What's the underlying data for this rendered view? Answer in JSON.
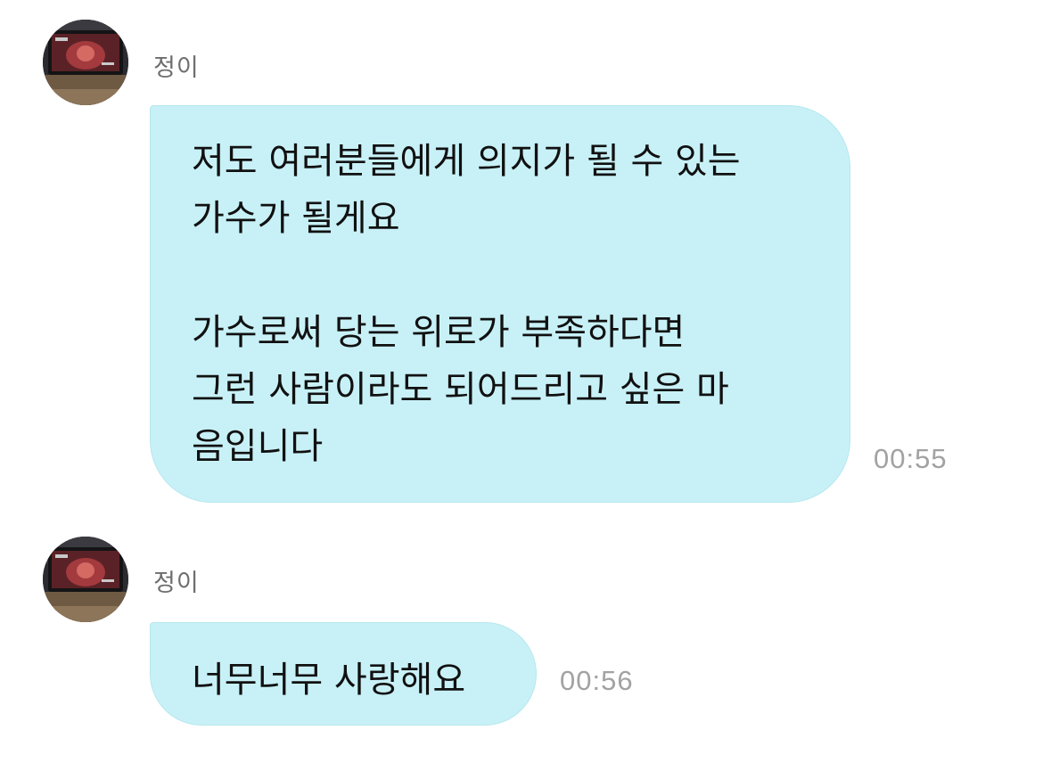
{
  "messages": [
    {
      "sender": "정이",
      "avatar": "performer-photo-avatar",
      "lines": [
        "저도 여러분들에게 의지가 될 수 있는",
        "가수가 될게요",
        "",
        "가수로써 당는 위로가 부족하다면",
        "그런 사람이라도 되어드리고 싶은 마",
        "음입니다"
      ],
      "time": "00:55"
    },
    {
      "sender": "정이",
      "avatar": "performer-photo-avatar",
      "lines": [
        "너무너무 사랑해요"
      ],
      "time": "00:56"
    }
  ],
  "colors": {
    "bubble": "#c8f1f7",
    "bubble_border": "#b6e7ee",
    "sender_text": "#6e6e6e",
    "time_text": "#a2a2a2",
    "message_text": "#111111"
  }
}
